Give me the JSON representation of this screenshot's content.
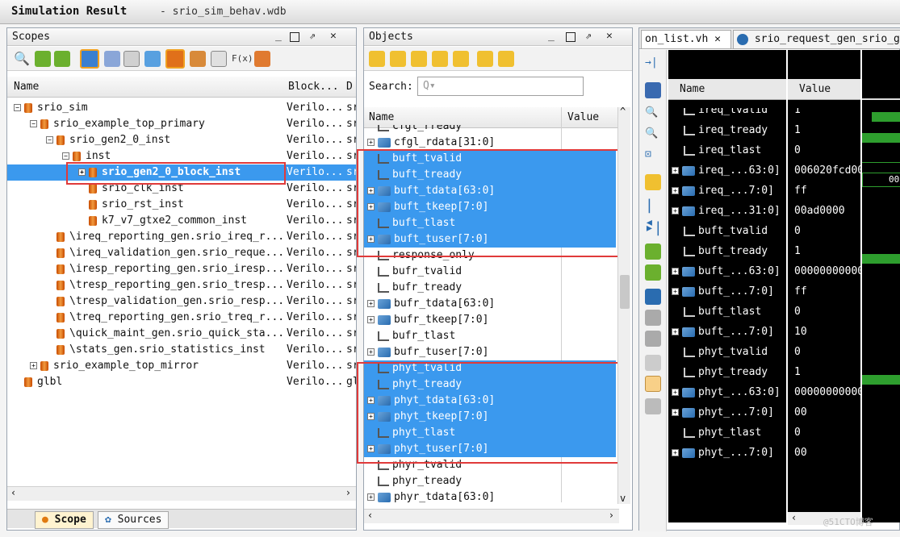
{
  "window": {
    "title": "Simulation Result",
    "subtitle": "- srio_sim_behav.wdb"
  },
  "scopes": {
    "title": "Scopes",
    "columns": [
      "Name",
      "Block...",
      "D"
    ],
    "rows": [
      {
        "indent": 0,
        "exp": "⊟",
        "name": "srio_sim",
        "block": "Verilo...",
        "d": "sr"
      },
      {
        "indent": 1,
        "exp": "⊟",
        "name": "srio_example_top_primary",
        "block": "Verilo...",
        "d": "sr"
      },
      {
        "indent": 2,
        "exp": "⊟",
        "name": "srio_gen2_0_inst",
        "block": "Verilo...",
        "d": "sr"
      },
      {
        "indent": 3,
        "exp": "⊟",
        "name": "inst",
        "block": "Verilo...",
        "d": "sr"
      },
      {
        "indent": 4,
        "exp": "⊞",
        "name": "srio_gen2_0_block_inst",
        "block": "Verilo...",
        "d": "sr",
        "selected": true
      },
      {
        "indent": 4,
        "exp": "",
        "name": "srio_clk_inst",
        "block": "Verilo...",
        "d": "sr"
      },
      {
        "indent": 4,
        "exp": "",
        "name": "srio_rst_inst",
        "block": "Verilo...",
        "d": "sr"
      },
      {
        "indent": 4,
        "exp": "",
        "name": "k7_v7_gtxe2_common_inst",
        "block": "Verilo...",
        "d": "sr"
      },
      {
        "indent": 2,
        "exp": "",
        "name": "\\ireq_reporting_gen.srio_ireq_r...",
        "block": "Verilo...",
        "d": "sr"
      },
      {
        "indent": 2,
        "exp": "",
        "name": "\\ireq_validation_gen.srio_reque...",
        "block": "Verilo...",
        "d": "sr"
      },
      {
        "indent": 2,
        "exp": "",
        "name": "\\iresp_reporting_gen.srio_iresp...",
        "block": "Verilo...",
        "d": "sr"
      },
      {
        "indent": 2,
        "exp": "",
        "name": "\\tresp_reporting_gen.srio_tresp...",
        "block": "Verilo...",
        "d": "sr"
      },
      {
        "indent": 2,
        "exp": "",
        "name": "\\tresp_validation_gen.srio_resp...",
        "block": "Verilo...",
        "d": "sr"
      },
      {
        "indent": 2,
        "exp": "",
        "name": "\\treq_reporting_gen.srio_treq_r...",
        "block": "Verilo...",
        "d": "sr"
      },
      {
        "indent": 2,
        "exp": "",
        "name": "\\quick_maint_gen.srio_quick_sta...",
        "block": "Verilo...",
        "d": "sr"
      },
      {
        "indent": 2,
        "exp": "",
        "name": "\\stats_gen.srio_statistics_inst",
        "block": "Verilo...",
        "d": "sr"
      },
      {
        "indent": 1,
        "exp": "⊞",
        "name": "srio_example_top_mirror",
        "block": "Verilo...",
        "d": "sr"
      },
      {
        "indent": 0,
        "exp": "",
        "name": "glbl",
        "block": "Verilo...",
        "d": "gl"
      }
    ],
    "tabs": [
      "Scope",
      "Sources"
    ]
  },
  "objects": {
    "title": "Objects",
    "search_label": "Search:",
    "search_placeholder": "Q▾",
    "columns": [
      "Name",
      "Value"
    ],
    "rows": [
      {
        "exp": "",
        "bus": false,
        "name": "cfgl_rready",
        "sel": false
      },
      {
        "exp": "⊞",
        "bus": true,
        "name": "cfgl_rdata[31:0]",
        "sel": false
      },
      {
        "exp": "",
        "bus": false,
        "name": "buft_tvalid",
        "sel": true
      },
      {
        "exp": "",
        "bus": false,
        "name": "buft_tready",
        "sel": true
      },
      {
        "exp": "⊞",
        "bus": true,
        "name": "buft_tdata[63:0]",
        "sel": true
      },
      {
        "exp": "⊞",
        "bus": true,
        "name": "buft_tkeep[7:0]",
        "sel": true
      },
      {
        "exp": "",
        "bus": false,
        "name": "buft_tlast",
        "sel": true
      },
      {
        "exp": "⊞",
        "bus": true,
        "name": "buft_tuser[7:0]",
        "sel": true
      },
      {
        "exp": "",
        "bus": false,
        "name": "response_only",
        "sel": false
      },
      {
        "exp": "",
        "bus": false,
        "name": "bufr_tvalid",
        "sel": false
      },
      {
        "exp": "",
        "bus": false,
        "name": "bufr_tready",
        "sel": false
      },
      {
        "exp": "⊞",
        "bus": true,
        "name": "bufr_tdata[63:0]",
        "sel": false
      },
      {
        "exp": "⊞",
        "bus": true,
        "name": "bufr_tkeep[7:0]",
        "sel": false
      },
      {
        "exp": "",
        "bus": false,
        "name": "bufr_tlast",
        "sel": false
      },
      {
        "exp": "⊞",
        "bus": true,
        "name": "bufr_tuser[7:0]",
        "sel": false
      },
      {
        "exp": "",
        "bus": false,
        "name": "phyt_tvalid",
        "sel": true
      },
      {
        "exp": "",
        "bus": false,
        "name": "phyt_tready",
        "sel": true
      },
      {
        "exp": "⊞",
        "bus": true,
        "name": "phyt_tdata[63:0]",
        "sel": true
      },
      {
        "exp": "⊞",
        "bus": true,
        "name": "phyt_tkeep[7:0]",
        "sel": true
      },
      {
        "exp": "",
        "bus": false,
        "name": "phyt_tlast",
        "sel": true
      },
      {
        "exp": "⊞",
        "bus": true,
        "name": "phyt_tuser[7:0]",
        "sel": true
      },
      {
        "exp": "",
        "bus": false,
        "name": "phyr_tvalid",
        "sel": false
      },
      {
        "exp": "",
        "bus": false,
        "name": "phyr_tready",
        "sel": false
      },
      {
        "exp": "⊞",
        "bus": true,
        "name": "phyr_tdata[63:0]",
        "sel": false
      }
    ]
  },
  "wave": {
    "tabs": [
      "on_list.vh",
      "srio_request_gen_srio_gen"
    ],
    "columns": [
      "Name",
      "Value"
    ],
    "rows": [
      {
        "exp": "",
        "bus": false,
        "name": "ireq_tvalid",
        "value": "1"
      },
      {
        "exp": "",
        "bus": false,
        "name": "ireq_tready",
        "value": "1"
      },
      {
        "exp": "",
        "bus": false,
        "name": "ireq_tlast",
        "value": "0"
      },
      {
        "exp": "⊞",
        "bus": true,
        "name": "ireq_...63:0]",
        "value": "006020fcd00"
      },
      {
        "exp": "⊞",
        "bus": true,
        "name": "ireq_...7:0]",
        "value": "ff"
      },
      {
        "exp": "⊞",
        "bus": true,
        "name": "ireq_...31:0]",
        "value": "00ad0000"
      },
      {
        "exp": "",
        "bus": false,
        "name": "buft_tvalid",
        "value": "0"
      },
      {
        "exp": "",
        "bus": false,
        "name": "buft_tready",
        "value": "1"
      },
      {
        "exp": "⊞",
        "bus": true,
        "name": "buft_...63:0]",
        "value": "00000000000"
      },
      {
        "exp": "⊞",
        "bus": true,
        "name": "buft_...7:0]",
        "value": "ff"
      },
      {
        "exp": "",
        "bus": false,
        "name": "buft_tlast",
        "value": "0"
      },
      {
        "exp": "⊞",
        "bus": true,
        "name": "buft_...7:0]",
        "value": "10"
      },
      {
        "exp": "",
        "bus": false,
        "name": "phyt_tvalid",
        "value": "0"
      },
      {
        "exp": "",
        "bus": false,
        "name": "phyt_tready",
        "value": "1"
      },
      {
        "exp": "⊞",
        "bus": true,
        "name": "phyt_...63:0]",
        "value": "00000000000"
      },
      {
        "exp": "⊞",
        "bus": true,
        "name": "phyt_...7:0]",
        "value": "00"
      },
      {
        "exp": "",
        "bus": false,
        "name": "phyt_tlast",
        "value": "0"
      },
      {
        "exp": "⊞",
        "bus": true,
        "name": "phyt_...7:0]",
        "value": "00"
      }
    ],
    "partial_value": "00"
  },
  "watermark": "@51CTO博客"
}
